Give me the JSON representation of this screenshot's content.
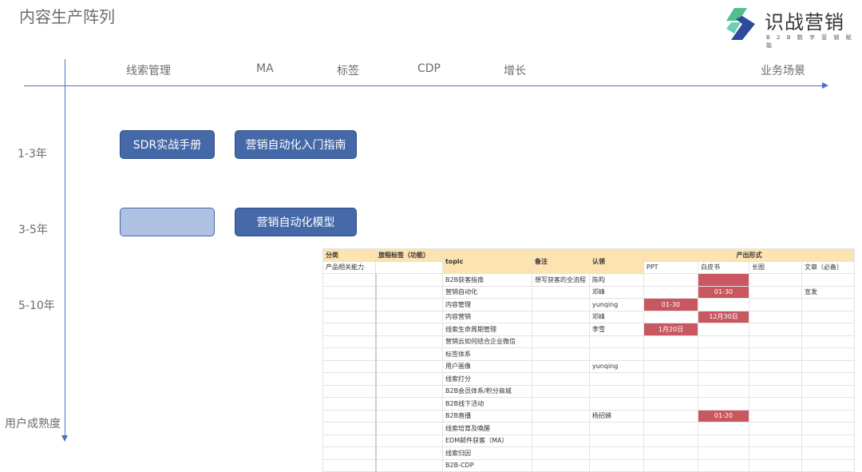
{
  "page_title": "内容生产阵列",
  "logo": {
    "name": "识战营销",
    "tagline": "B 2 B 数 字 营 销 赋 能"
  },
  "columns": [
    "线索管理",
    "MA",
    "标签",
    "CDP",
    "增长",
    "业务场景"
  ],
  "rows": [
    "1-3年",
    "3-5年",
    "5-10年",
    "用户成熟度"
  ],
  "boxes": {
    "sdr": "SDR实战手册",
    "ma_intro": "营销自动化入门指南",
    "empty": "",
    "ma_model": "营销自动化模型"
  },
  "table": {
    "headers": {
      "category": "分类",
      "journey": "旅程标签（功能）",
      "topic": "topic",
      "note": "备注",
      "claim": "认领",
      "output": "产出形式",
      "sub_category": "产品相关能力",
      "ppt": "PPT",
      "whitepaper": "白皮书",
      "infographic": "长图",
      "article": "文章（必备）"
    },
    "rows": [
      {
        "topic": "B2B获客指南",
        "note": "想写获客的全流程",
        "claim": "陈昀",
        "ppt": "",
        "whitepaper": "",
        "infographic": "",
        "article": "",
        "wp_red": true
      },
      {
        "topic": "营销自动化",
        "note": "",
        "claim": "邓峰",
        "ppt": "",
        "whitepaper": "01-30",
        "infographic": "",
        "article": "宣发",
        "wp_red": true
      },
      {
        "topic": "内容管理",
        "note": "",
        "claim": "yunqing",
        "ppt": "01-30",
        "whitepaper": "",
        "infographic": "",
        "article": "",
        "ppt_red": true
      },
      {
        "topic": "内容营销",
        "note": "",
        "claim": "邓峰",
        "ppt": "",
        "whitepaper": "12月30日",
        "infographic": "",
        "article": "",
        "wp_red": true
      },
      {
        "topic": "线索生命周期管理",
        "note": "",
        "claim": "李雪",
        "ppt": "1月20日",
        "whitepaper": "",
        "infographic": "",
        "article": "",
        "ppt_red": true
      },
      {
        "topic": "营销云如何结合企业微信",
        "note": "",
        "claim": "",
        "ppt": "",
        "whitepaper": "",
        "infographic": "",
        "article": ""
      },
      {
        "topic": "标签体系",
        "note": "",
        "claim": "",
        "ppt": "",
        "whitepaper": "",
        "infographic": "",
        "article": ""
      },
      {
        "topic": "用户画像",
        "note": "",
        "claim": "yunqing",
        "ppt": "",
        "whitepaper": "",
        "infographic": "",
        "article": ""
      },
      {
        "topic": "线索打分",
        "note": "",
        "claim": "",
        "ppt": "",
        "whitepaper": "",
        "infographic": "",
        "article": ""
      },
      {
        "topic": "B2B会员体系/积分商城",
        "note": "",
        "claim": "",
        "ppt": "",
        "whitepaper": "",
        "infographic": "",
        "article": ""
      },
      {
        "topic": "B2B线下活动",
        "note": "",
        "claim": "",
        "ppt": "",
        "whitepaper": "",
        "infographic": "",
        "article": ""
      },
      {
        "topic": "B2B直播",
        "note": "",
        "claim": "杨招娣",
        "ppt": "",
        "whitepaper": "01-20",
        "infographic": "",
        "article": "",
        "wp_red": true
      },
      {
        "topic": "线索培育及唤醒",
        "note": "",
        "claim": "",
        "ppt": "",
        "whitepaper": "",
        "infographic": "",
        "article": ""
      },
      {
        "topic": "EDM邮件获客（MA）",
        "note": "",
        "claim": "",
        "ppt": "",
        "whitepaper": "",
        "infographic": "",
        "article": ""
      },
      {
        "topic": "线索归因",
        "note": "",
        "claim": "",
        "ppt": "",
        "whitepaper": "",
        "infographic": "",
        "article": ""
      },
      {
        "topic": "B2B-CDP",
        "note": "",
        "claim": "",
        "ppt": "",
        "whitepaper": "",
        "infographic": "",
        "article": ""
      }
    ]
  }
}
